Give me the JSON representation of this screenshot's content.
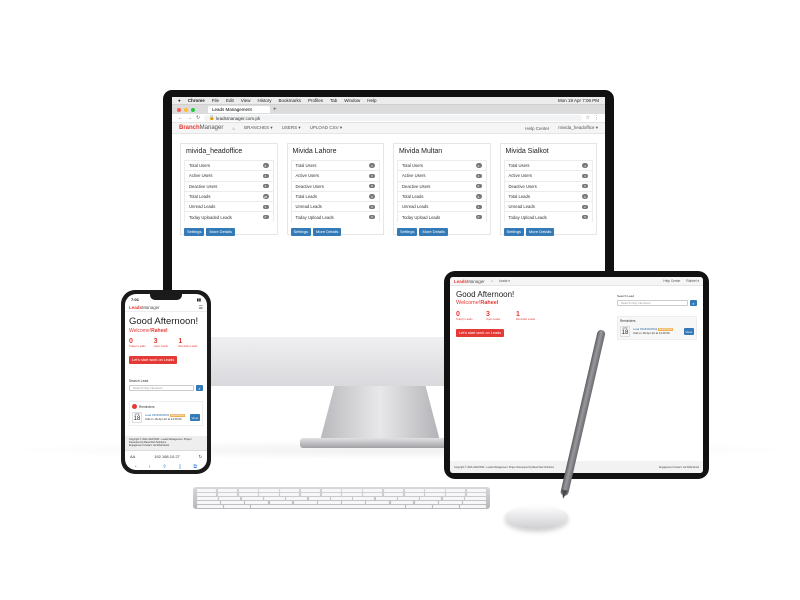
{
  "mac_menubar": {
    "app": "Chrome",
    "items": [
      "File",
      "Edit",
      "View",
      "History",
      "Bookmarks",
      "Profiles",
      "Tab",
      "Window",
      "Help"
    ],
    "clock": "Mon 19 Apr  7:06 PM"
  },
  "browser": {
    "tab_title": "Leads Management",
    "url": "leadsmanager.com.pk"
  },
  "desktop_nav": {
    "brand_strong": "Branch",
    "brand_light": "Manager",
    "items": [
      "BRANCHES ▾",
      "USERS ▾",
      "UPLOAD CSV ▾"
    ],
    "help": "Help Center",
    "user": "mivida_headoffice ▾"
  },
  "branch_labels": [
    "Total Users",
    "Active Users",
    "Deactive Users",
    "Total Leads",
    "Unread Leads",
    "Today Uploaded Leads"
  ],
  "branches": [
    {
      "name": "mivida_headoffice",
      "labels": [
        "Total Users",
        "Active Users",
        "Deactive Users",
        "Total Leads",
        "Unread Leads",
        "Today Uploaded Leads"
      ],
      "counts": [
        "8",
        "4",
        "4",
        "28",
        "3",
        "0"
      ]
    },
    {
      "name": "Mivida Lahore",
      "labels": [
        "Total Users",
        "Active Users",
        "Deactive Users",
        "Total Leads",
        "Unread Leads",
        "Today Upload Leads"
      ],
      "counts": [
        "3",
        "3",
        "0",
        "5",
        "0",
        "0"
      ]
    },
    {
      "name": "Mivida Multan",
      "labels": [
        "Total Users",
        "Active Users",
        "Deactive Users",
        "Total Leads",
        "Unread Leads",
        "Today Upload Leads"
      ],
      "counts": [
        "4",
        "4",
        "0",
        "6",
        "1",
        "0"
      ]
    },
    {
      "name": "Mivida Sialkot",
      "labels": [
        "Total Users",
        "Active Users",
        "Deactive Users",
        "Total Leads",
        "Unread Leads",
        "Today Upload Leads"
      ],
      "counts": [
        "4",
        "4",
        "0",
        "6",
        "2",
        "0"
      ]
    }
  ],
  "branch_buttons": {
    "settings": "Settings",
    "details": "More Details"
  },
  "mobile": {
    "time": "7:01",
    "brand_strong": "Leads",
    "brand_light": "Manager",
    "greeting": "Good Afternoon!",
    "welcome": "Welcome!",
    "user": "Raheel",
    "stats": [
      {
        "value": "0",
        "label": "Today's Leads"
      },
      {
        "value": "3",
        "label": "Open Leads"
      },
      {
        "value": "1",
        "label": "Reminder Leads"
      }
    ],
    "cta": "Let's start work on Leads",
    "search_label": "Search Lead",
    "search_placeholder": "Search Only Numbers",
    "reminder_title": "Reminders",
    "reminder_month": "APR",
    "reminder_day": "18",
    "reminder_lead": "Lead 03183000543",
    "reminder_tag": "Appointment",
    "reminder_text": "Call on 18-Apr-22 at 14:00:00",
    "view": "View",
    "footer_line1": "Copyright © 2021-2022 BAR - Leads Management. Project Developed by Bana Web Solutions",
    "footer_line2": "Engagement Contact: via What'sbook",
    "url_left": "AA",
    "url": "192.168.10.27",
    "refresh": "↻"
  },
  "tablet": {
    "brand_strong": "Leads",
    "brand_light": "Manager",
    "user_menu": "Leads ▾",
    "help": "Help Center",
    "user": "Raheel ▾",
    "greeting": "Good Afternoon!",
    "welcome": "Welcome!",
    "user_name": "Raheel",
    "stats": [
      {
        "value": "0",
        "label": "Today's Leads"
      },
      {
        "value": "3",
        "label": "Open Leads"
      },
      {
        "value": "1",
        "label": "Reminder Leads"
      }
    ],
    "cta": "Let's start work on Leads",
    "search_label": "Search Lead",
    "search_placeholder": "Search Only Numbers",
    "reminder_title": "Reminders",
    "reminder_month": "APR",
    "reminder_day": "18",
    "reminder_lead": "Lead 03183000543",
    "reminder_tag": "Appointment",
    "reminder_text": "Call on 18-Apr-22 at 14:00:00",
    "view": "View",
    "footer_left": "Copyright © 2021-2022 BAR - Leads Management. Project Developed by Bana Web Solutions",
    "footer_right": "Engagement Contact: via What'sbook"
  },
  "colors": {
    "brand_red": "#e53935",
    "button_blue": "#337ab7"
  }
}
